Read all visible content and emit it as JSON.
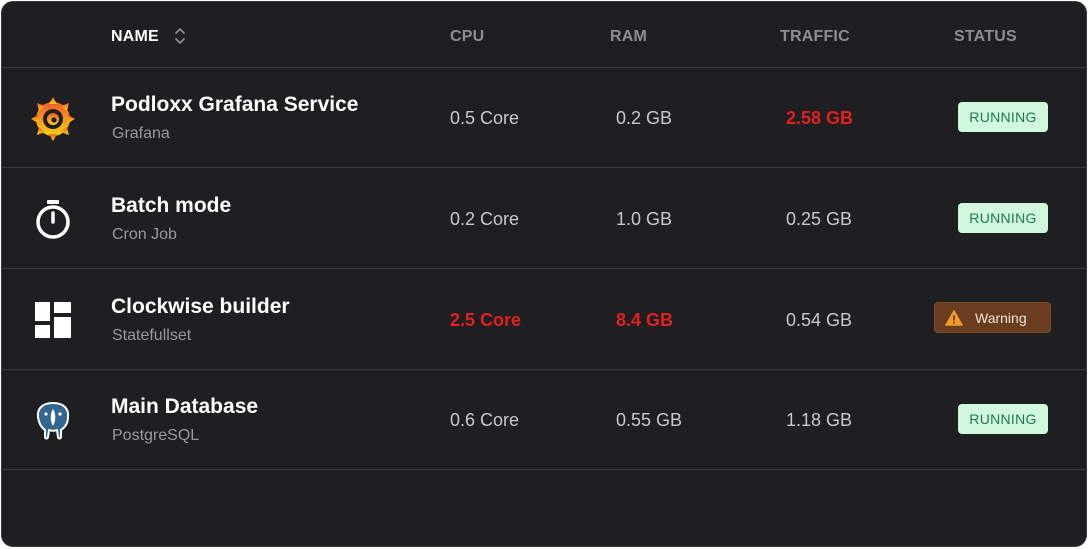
{
  "header": {
    "name": "NAME",
    "cpu": "CPU",
    "ram": "RAM",
    "traffic": "TRAFFIC",
    "status": "STATUS",
    "sort_icon": "sort-icon"
  },
  "rows": [
    {
      "icon": "grafana-logo-icon",
      "title": "Podloxx Grafana Service",
      "subtitle": "Grafana",
      "cpu": "0.5 Core",
      "ram": "0.2 GB",
      "traffic": "2.58 GB",
      "status": "RUNNING"
    },
    {
      "icon": "stopwatch-icon",
      "title": "Batch mode",
      "subtitle": "Cron Job",
      "cpu": "0.2 Core",
      "ram": "1.0 GB",
      "traffic": "0.25 GB",
      "status": "RUNNING"
    },
    {
      "icon": "dashboard-grid-icon",
      "title": "Clockwise builder",
      "subtitle": "Statefullset",
      "cpu": "2.5 Core",
      "ram": "8.4 GB",
      "traffic": "0.54 GB",
      "status": "Warning"
    },
    {
      "icon": "postgresql-elephant-icon",
      "title": "Main Database",
      "subtitle": "PostgreSQL",
      "cpu": "0.6 Core",
      "ram": "0.55 GB",
      "traffic": "1.18 GB",
      "status": "RUNNING"
    }
  ],
  "colors": {
    "background": "#1f1e21",
    "alert_text": "#e31f1f",
    "running_bg": "#d1f7de",
    "running_text": "#1f7a45",
    "warning_bg": "#6a3d1f",
    "warning_icon": "#f39a2b"
  }
}
